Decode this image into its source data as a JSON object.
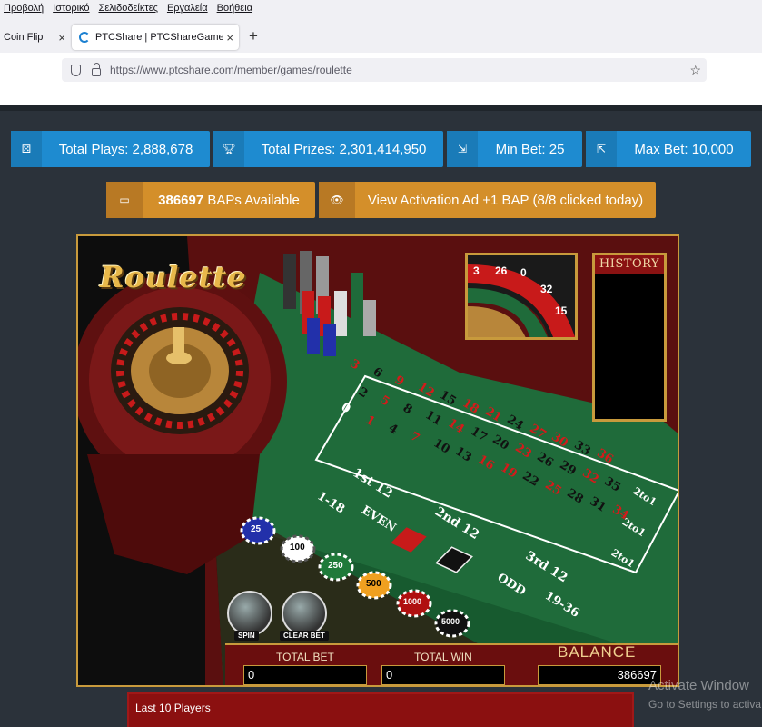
{
  "browser": {
    "menu": [
      "Προβολή",
      "Ιστορικό",
      "Σελιδοδείκτες",
      "Εργαλεία",
      "Βοήθεια"
    ],
    "tabs": [
      {
        "title": "Coin Flip",
        "close": "×"
      },
      {
        "title": "PTCShare | PTCShareGames - Ro",
        "close": "×"
      }
    ],
    "new_tab": "+",
    "url_host": "https://www.ptcshare.com",
    "url_path": "/member/games/roulette",
    "star": "☆"
  },
  "stats": {
    "total_plays": "Total Plays: 2,888,678",
    "total_prizes": "Total Prizes: 2,301,414,950",
    "min_bet": "Min Bet: 25",
    "max_bet": "Max Bet: 10,000"
  },
  "baps": {
    "count": "386697",
    "label": " BAPs Available"
  },
  "activation": {
    "label": "View Activation Ad +1 BAP (8/8 clicked today)"
  },
  "game": {
    "logo": "Roulette",
    "history_title": "HISTORY",
    "preview_numbers": [
      "3",
      "26",
      "0",
      "32",
      "15"
    ],
    "spin_label": "SPIN",
    "clear_bet_label": "CLEAR BET",
    "total_bet_label": "TOTAL BET",
    "total_win_label": "TOTAL WIN",
    "balance_label": "BALANCE",
    "total_bet_value": "0",
    "total_win_value": "0",
    "balance_value": "386697",
    "chips": [
      "25",
      "100",
      "250",
      "500",
      "1000",
      "5000"
    ],
    "table": {
      "zero": "0",
      "rows": [
        [
          "3",
          "6",
          "9",
          "12",
          "15",
          "18",
          "21",
          "24",
          "27",
          "30",
          "33",
          "36"
        ],
        [
          "2",
          "5",
          "8",
          "11",
          "14",
          "17",
          "20",
          "23",
          "26",
          "29",
          "32",
          "35"
        ],
        [
          "1",
          "4",
          "7",
          "10",
          "13",
          "16",
          "19",
          "22",
          "25",
          "28",
          "31",
          "34"
        ]
      ],
      "column_bets": [
        "2to1",
        "2to1",
        "2to1"
      ],
      "dozens": [
        "1st 12",
        "2nd 12",
        "3rd 12"
      ],
      "outside": [
        "1-18",
        "EVEN",
        "ODD",
        "19-36"
      ]
    }
  },
  "last_players": {
    "title": "Last 10 Players"
  },
  "watermark": {
    "line1": "Activate Window",
    "line2": "Go to Settings to activa"
  },
  "colors": {
    "red": "#c81a1a",
    "black": "#111111",
    "felt": "#1f6b3a",
    "blue_stat": "#1e8bd0",
    "orange_btn": "#d48f2a"
  }
}
